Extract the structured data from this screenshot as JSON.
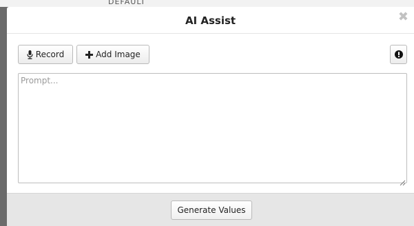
{
  "backdrop": {
    "text": "DEFAULT"
  },
  "dialog": {
    "title": "AI Assist",
    "close_icon": "close-icon"
  },
  "toolbar": {
    "record_label": "Record",
    "record_icon": "microphone-icon",
    "add_image_label": "Add Image",
    "add_image_icon": "plus-icon",
    "info_icon": "info-icon"
  },
  "prompt": {
    "placeholder": "Prompt...",
    "value": ""
  },
  "footer": {
    "generate_label": "Generate Values"
  },
  "colors": {
    "backdrop": "#6b6b6b",
    "footer_bg": "#e6e6e6",
    "close_icon": "#c2c2c2"
  }
}
